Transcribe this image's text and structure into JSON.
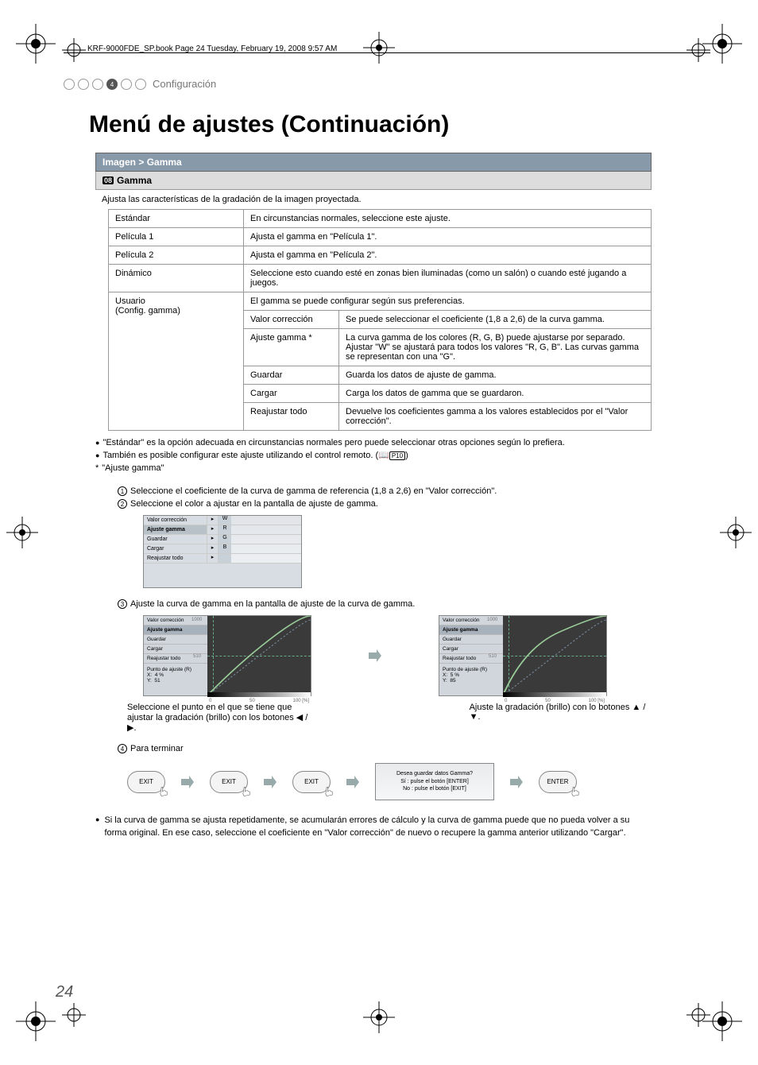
{
  "framemaker_note": "KRF-9000FDE_SP.book  Page 24  Tuesday, February 19, 2008  9:57 AM",
  "breadcrumb": {
    "active_index": "4",
    "label": "Configuración"
  },
  "title": "Menú de ajustes (Continuación)",
  "section_header": "Imagen > Gamma",
  "sub_header_tag": "08",
  "sub_header": "Gamma",
  "section_desc": "Ajusta las características de la gradación de la imagen proyectada.",
  "rows": {
    "estandar": {
      "label": "Estándar",
      "desc": "En circunstancias normales, seleccione este ajuste."
    },
    "pelicula1": {
      "label": "Película 1",
      "desc": "Ajusta el gamma en \"Película 1\"."
    },
    "pelicula2": {
      "label": "Película 2",
      "desc": "Ajusta el gamma en \"Película 2\"."
    },
    "dinamico": {
      "label": "Dinámico",
      "desc": "Seleccione esto cuando esté en zonas bien iluminadas (como un salón) o cuando esté jugando a juegos."
    },
    "usuario": {
      "label": "Usuario",
      "sub": "(Config. gamma)",
      "desc": "El gamma se puede configurar según sus preferencias."
    },
    "valor": {
      "label": "Valor corrección",
      "desc": "Se puede seleccionar el coeficiente (1,8 a 2,6) de la curva gamma."
    },
    "ajuste": {
      "label": "Ajuste gamma *",
      "desc1": "La curva gamma de los colores (R, G, B) puede ajustarse por separado.",
      "desc2": "Ajustar \"W\" se ajustará para todos los valores \"R, G, B\". Las curvas gamma se representan con una \"G\"."
    },
    "guardar": {
      "label": "Guardar",
      "desc": "Guarda los datos de ajuste de gamma."
    },
    "cargar": {
      "label": "Cargar",
      "desc": "Carga los datos de gamma que se guardaron."
    },
    "reajustar": {
      "label": "Reajustar todo",
      "desc": "Devuelve los coeficientes gamma a los valores establecidos por el \"Valor corrección\"."
    }
  },
  "notes": {
    "n1": "\"Estándar\" es la opción adecuada en circunstancias normales pero puede seleccionar otras opciones según lo prefiera.",
    "n2a": "También es posible configurar este ajuste utilizando el control remoto. (",
    "n2b": "P10",
    "n2c": ")",
    "n3": "\"Ajuste gamma\"",
    "s1": "Seleccione el coeficiente de la curva de gamma de referencia (1,8 a 2,6) en \"Valor corrección\".",
    "s2": "Seleccione el color a ajustar en la pantalla de ajuste de gamma.",
    "s3": "Ajuste la curva de gamma en la pantalla de ajuste de la curva de gamma.",
    "cap1": "Seleccione el punto en el que se tiene que ajustar la gradación (brillo) con los botones ◀ / ▶.",
    "cap2": "Ajuste la gradación (brillo) con lo botones ▲ / ▼.",
    "s4": "Para terminar",
    "final": "Si la curva de gamma se ajusta repetidamente, se acumularán errores de cálculo y la curva de gamma puede que no pueda volver a su forma original. En ese caso, seleccione el coeficiente en \"Valor corrección\" de nuevo o recupere la gamma anterior utilizando \"Cargar\"."
  },
  "menu_ss": {
    "items": [
      "Valor corrección",
      "Ajuste gamma",
      "Guardar",
      "Cargar",
      "Reajustar todo"
    ],
    "colors": [
      "W",
      "R",
      "G",
      "B"
    ],
    "point_label": "Punto de ajuste (R)",
    "px": "X:",
    "px_v1": "4  %",
    "px_v2": "5  %",
    "py": "Y:",
    "py_v1": "51",
    "py_v2": "85",
    "ytop": "1000",
    "ymid": "510",
    "x0": "0",
    "x50": "50",
    "x100": "100 [%]"
  },
  "buttons": {
    "exit": "EXIT",
    "enter": "ENTER"
  },
  "dialog": {
    "line1": "Desea guardar datos Gamma?",
    "line2": "Sí  : pulse el botón [ENTER]",
    "line3": "No : pulse el botón [EXIT]"
  },
  "page_number": "24"
}
